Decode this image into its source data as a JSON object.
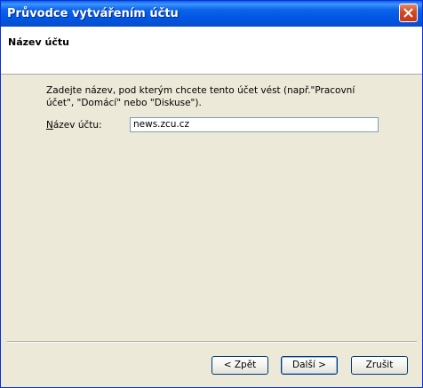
{
  "window": {
    "title": "Průvodce vytvářením účtu",
    "close_icon": "close-icon"
  },
  "header": {
    "title": "Název účtu"
  },
  "content": {
    "description": "Zadejte název, pod kterým chcete tento účet vést (např.\"Pracovní účet\", \"Domácí\" nebo \"Diskuse\").",
    "account_name_label_underlined": "N",
    "account_name_label_rest": "ázev účtu:",
    "account_name_value": "news.zcu.cz"
  },
  "buttons": {
    "back": "< Zpět",
    "next": "Další >",
    "cancel": "Zrušit"
  }
}
